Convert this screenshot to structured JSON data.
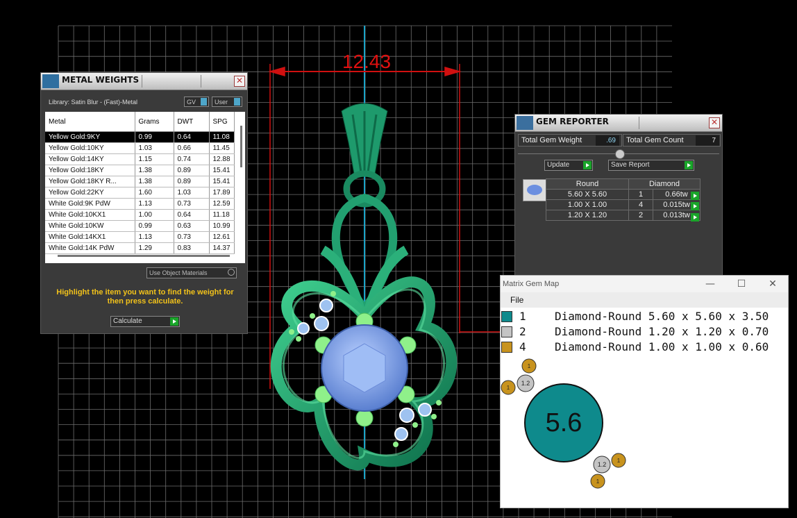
{
  "viewport": {
    "dimension_label": "12.43",
    "colors": {
      "grid": "#6e6e6e",
      "dimension": "#e01010",
      "axis": "#1aa3c7",
      "metal": "#20a070",
      "gem": "#7da5e8"
    }
  },
  "metal_weights": {
    "title": "METAL WEIGHTS",
    "library": "Library: Satin Blur - (Fast)-Metal",
    "toggle_gv": "GV",
    "toggle_user": "User",
    "columns": [
      "Metal",
      "Grams",
      "DWT",
      "SPG"
    ],
    "rows": [
      [
        "Yellow Gold:9KY",
        "0.99",
        "0.64",
        "11.08"
      ],
      [
        "Yellow Gold:10KY",
        "1.03",
        "0.66",
        "11.45"
      ],
      [
        "Yellow Gold:14KY",
        "1.15",
        "0.74",
        "12.88"
      ],
      [
        "Yellow Gold:18KY",
        "1.38",
        "0.89",
        "15.41"
      ],
      [
        "Yellow Gold:18KY R...",
        "1.38",
        "0.89",
        "15.41"
      ],
      [
        "Yellow Gold:22KY",
        "1.60",
        "1.03",
        "17.89"
      ],
      [
        "White Gold:9K PdW",
        "1.13",
        "0.73",
        "12.59"
      ],
      [
        "White Gold:10KX1",
        "1.00",
        "0.64",
        "11.18"
      ],
      [
        "White Gold:10KW",
        "0.99",
        "0.63",
        "10.99"
      ],
      [
        "White Gold:14KX1",
        "1.13",
        "0.73",
        "12.61"
      ],
      [
        "White Gold:14K PdW",
        "1.29",
        "0.83",
        "14.37"
      ]
    ],
    "use_object_materials": "Use Object Materials",
    "hint": "Highlight the item you want to find the weight for then press calculate.",
    "calculate": "Calculate",
    "close": "✕"
  },
  "gem_reporter": {
    "title": "GEM REPORTER",
    "total_weight_label": "Total Gem Weight",
    "total_weight_value": ".69",
    "total_count_label": "Total Gem Count",
    "total_count_value": "7",
    "update": "Update",
    "save_report": "Save Report",
    "columns": [
      "Round",
      "Diamond"
    ],
    "rows": [
      [
        "5.60 X 5.60",
        "1",
        "0.66tw"
      ],
      [
        "1.00 X 1.00",
        "4",
        "0.015tw"
      ],
      [
        "1.20 X 1.20",
        "2",
        "0.013tw"
      ]
    ],
    "close": "✕"
  },
  "gem_map": {
    "title": "Matrix Gem Map",
    "menu_file": "File",
    "legend": [
      {
        "count": "1",
        "desc": "Diamond-Round 5.60 x 5.60 x 3.50",
        "color": "#0e8a8c"
      },
      {
        "count": "2",
        "desc": "Diamond-Round 1.20 x 1.20 x 0.70",
        "color": "#c4c4c4"
      },
      {
        "count": "4",
        "desc": "Diamond-Round 1.00 x 1.00 x 0.60",
        "color": "#c8931e"
      }
    ],
    "bubble_labels": {
      "large": "5.6",
      "medium": "1.2",
      "small": "1"
    },
    "btn_min": "—",
    "btn_max": "☐",
    "btn_close": "✕"
  }
}
